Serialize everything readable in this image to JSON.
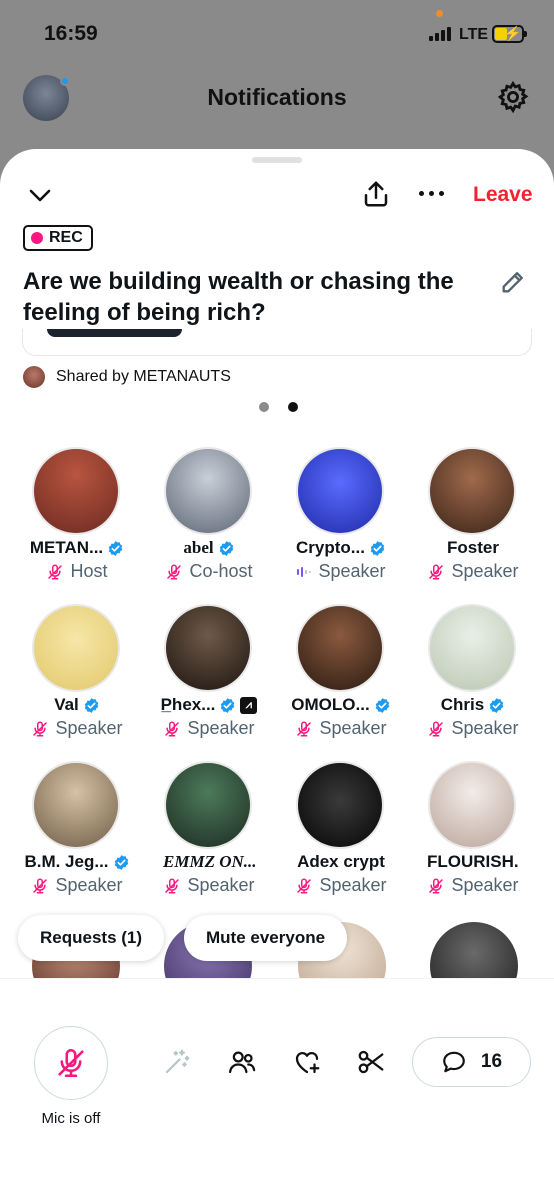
{
  "status_bar": {
    "time": "16:59",
    "network": "LTE"
  },
  "nav": {
    "title": "Notifications"
  },
  "space": {
    "leave_label": "Leave",
    "rec_label": "REC",
    "title": "Are we building wealth or chasing the feeling of being rich?",
    "shared_by": "Shared by METANAUTS",
    "page_count": 2,
    "active_page": 2
  },
  "participants": [
    {
      "name": "METAN...",
      "verified": true,
      "role": "Host",
      "role_icon": "mic-off-icon"
    },
    {
      "name": "abel",
      "verified": true,
      "role": "Co-host",
      "role_icon": "mic-off-icon"
    },
    {
      "name": "Crypto...",
      "verified": true,
      "role": "Speaker",
      "role_icon": "speaking-icon"
    },
    {
      "name": "Foster",
      "verified": false,
      "role": "Speaker",
      "role_icon": "mic-off-icon"
    },
    {
      "name": "Val",
      "verified": true,
      "role": "Speaker",
      "role_icon": "mic-off-icon"
    },
    {
      "name": "P̲hex...",
      "verified": true,
      "role": "Speaker",
      "role_icon": "mic-off-icon"
    },
    {
      "name": "OMOLO...",
      "verified": true,
      "role": "Speaker",
      "role_icon": "mic-off-icon"
    },
    {
      "name": "Chris",
      "verified": true,
      "role": "Speaker",
      "role_icon": "mic-off-icon"
    },
    {
      "name": "B.M. Jeg...",
      "verified": true,
      "role": "Speaker",
      "role_icon": "mic-off-icon"
    },
    {
      "name": "EMMZ ON...",
      "verified": false,
      "role": "Speaker",
      "role_icon": "mic-off-icon"
    },
    {
      "name": "Adex crypt",
      "verified": false,
      "role": "Speaker",
      "role_icon": "mic-off-icon"
    },
    {
      "name": "FLOURISH...",
      "verified": false,
      "role": "Speaker",
      "role_icon": "mic-off-icon"
    }
  ],
  "pills": {
    "requests": "Requests (1)",
    "mute_everyone": "Mute everyone"
  },
  "bottom_bar": {
    "mic_label": "Mic is off",
    "comment_count": "16"
  },
  "colors": {
    "accent_red": "#f4212e",
    "rec_pink": "#f91880",
    "mic_off_pink": "#f91880",
    "verified_blue": "#1d9bf0",
    "speaking_purple": "#7856ff"
  }
}
